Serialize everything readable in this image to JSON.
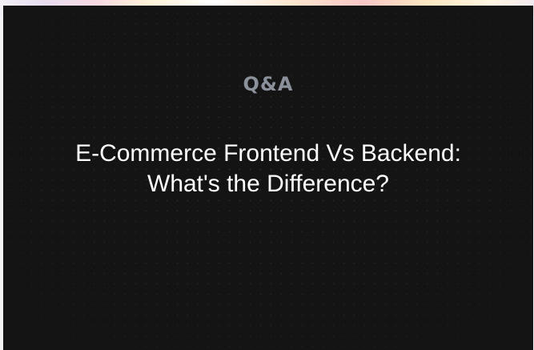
{
  "card": {
    "kicker": "Q&A",
    "title": "E-Commerce Frontend Vs Backend: What's the Difference?"
  }
}
